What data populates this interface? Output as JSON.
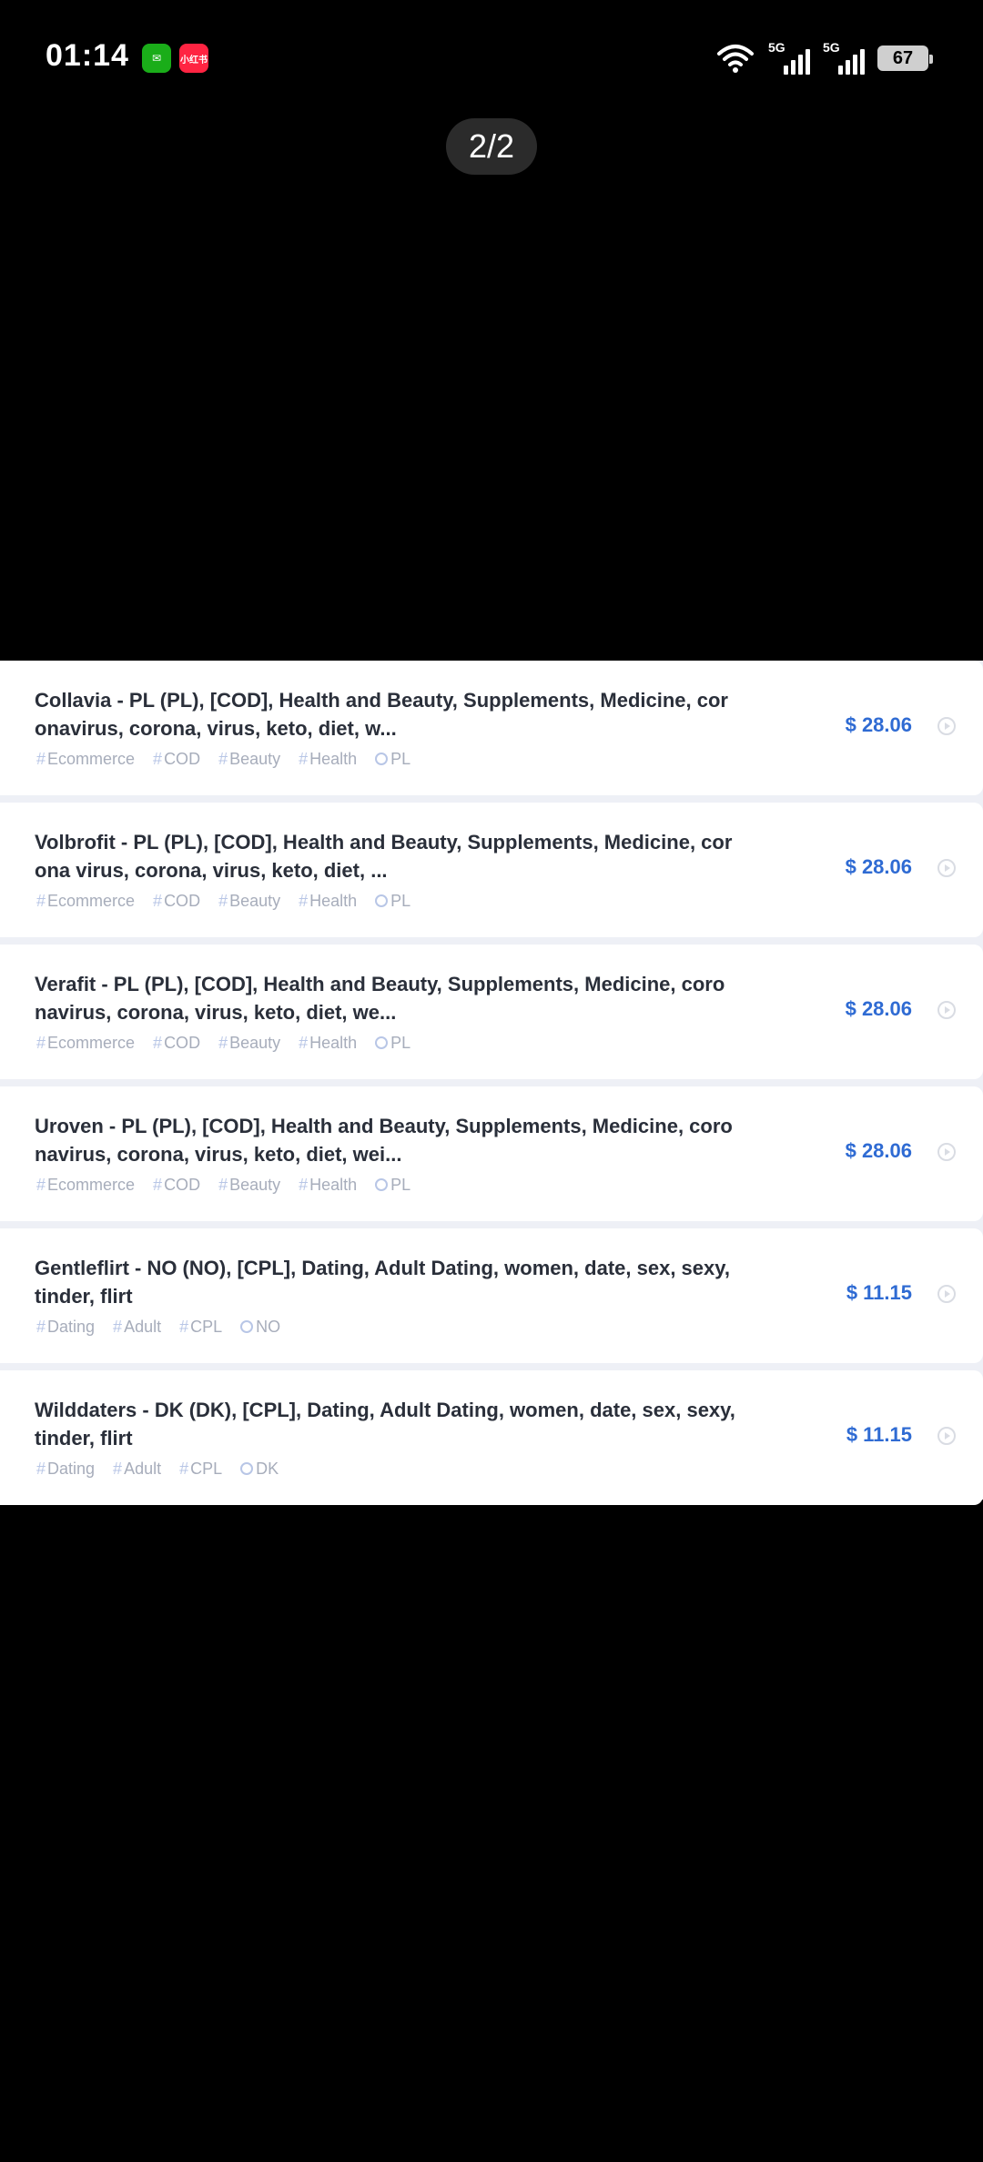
{
  "status_bar": {
    "time": "01:14",
    "network_1": "5G",
    "network_2": "5G",
    "battery": "67",
    "apps": [
      "wechat-icon",
      "xiaohongshu-icon"
    ],
    "redbook_label": "小红书"
  },
  "page_indicator": "2/2",
  "offers": [
    {
      "title": "Collavia - PL (PL), [COD], Health and Beauty, Supplements, Medicine, coronavirus, corona, virus, keto, diet, w...",
      "tags": [
        "Ecommerce",
        "COD",
        "Beauty",
        "Health"
      ],
      "geo": "PL",
      "price": "$ 28.06"
    },
    {
      "title": "Volbrofit - PL (PL), [COD], Health and Beauty, Supplements, Medicine, corona virus, corona, virus, keto, diet, ...",
      "tags": [
        "Ecommerce",
        "COD",
        "Beauty",
        "Health"
      ],
      "geo": "PL",
      "price": "$ 28.06"
    },
    {
      "title": "Verafit - PL (PL), [COD], Health and Beauty, Supplements, Medicine, coronavirus, corona, virus, keto, diet, we...",
      "tags": [
        "Ecommerce",
        "COD",
        "Beauty",
        "Health"
      ],
      "geo": "PL",
      "price": "$ 28.06"
    },
    {
      "title": "Uroven - PL (PL), [COD], Health and Beauty, Supplements, Medicine, coronavirus, corona, virus, keto, diet, wei...",
      "tags": [
        "Ecommerce",
        "COD",
        "Beauty",
        "Health"
      ],
      "geo": "PL",
      "price": "$ 28.06"
    },
    {
      "title": "Gentleflirt - NO (NO), [CPL], Dating, Adult Dating, women, date, sex, sexy, tinder, flirt",
      "tags": [
        "Dating",
        "Adult",
        "CPL"
      ],
      "geo": "NO",
      "price": "$ 11.15"
    },
    {
      "title": "Wilddaters - DK (DK), [CPL], Dating, Adult Dating, women, date, sex, sexy, tinder, flirt",
      "tags": [
        "Dating",
        "Adult",
        "CPL"
      ],
      "geo": "DK",
      "price": "$ 11.15"
    }
  ]
}
